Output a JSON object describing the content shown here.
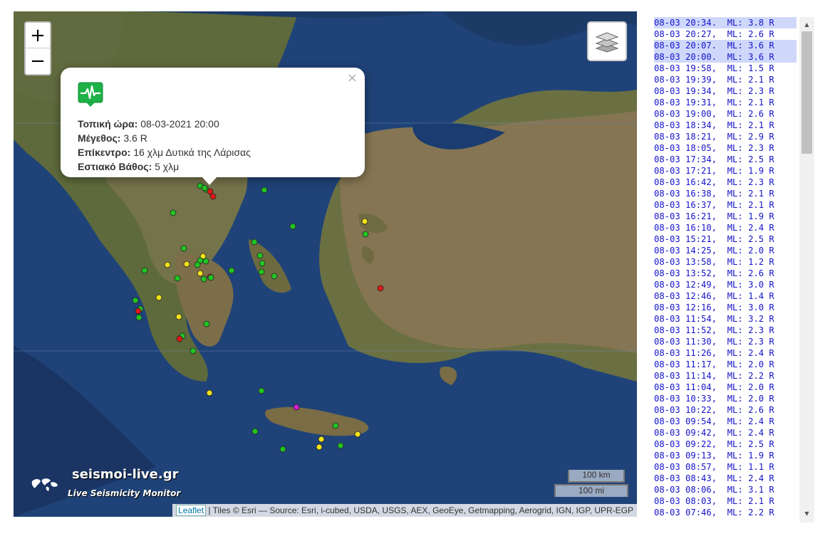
{
  "map": {
    "zoom_in": "+",
    "zoom_out": "−",
    "layers_icon": "layers-icon",
    "popup": {
      "close": "×",
      "icon": "seismograph-icon",
      "time_label": "Τοπική ώρα:",
      "time_value": "08-03-2021 20:00",
      "magnitude_label": "Μέγεθος:",
      "magnitude_value": "3.6 R",
      "epicenter_label": "Επίκεντρο:",
      "epicenter_value": "16 χλμ Δυτικά της Λάρισας",
      "depth_label": "Εστιακό Βάθος:",
      "depth_value": "5 χλμ"
    },
    "logo_title": "seismoi-live.gr",
    "logo_subtitle": "Live Seismicity Monitor",
    "scale_km": "100 km",
    "scale_mi": "100 mi",
    "attribution_link": "Leaflet",
    "attribution_text": " | Tiles © Esri — Source: Esri, i-cubed, USDA, USGS, AEX, GeoEye, Getmapping, Aerogrid, IGN, IGP, UPR-EGP",
    "marker_colors": {
      "green": "#22c422",
      "yellow": "#f2e21a",
      "red": "#e01818",
      "magenta": "#d21ed2"
    }
  },
  "quakes": [
    {
      "text": "08-03 20:34.  ML: 3.8 R",
      "hl": true
    },
    {
      "text": "08-03 20:27,  ML: 2.6 R",
      "hl": false
    },
    {
      "text": "08-03 20:07.  ML: 3.6 R",
      "hl": true
    },
    {
      "text": "08-03 20:00.  ML: 3.6 R",
      "hl": true
    },
    {
      "text": "08-03 19:58,  ML: 1.5 R",
      "hl": false
    },
    {
      "text": "08-03 19:39,  ML: 2.1 R",
      "hl": false
    },
    {
      "text": "08-03 19:34,  ML: 2.3 R",
      "hl": false
    },
    {
      "text": "08-03 19:31,  ML: 2.1 R",
      "hl": false
    },
    {
      "text": "08-03 19:00,  ML: 2.6 R",
      "hl": false
    },
    {
      "text": "08-03 18:34,  ML: 2.1 R",
      "hl": false
    },
    {
      "text": "08-03 18:21,  ML: 2.9 R",
      "hl": false
    },
    {
      "text": "08-03 18:05,  ML: 2.3 R",
      "hl": false
    },
    {
      "text": "08-03 17:34,  ML: 2.5 R",
      "hl": false
    },
    {
      "text": "08-03 17:21,  ML: 1.9 R",
      "hl": false
    },
    {
      "text": "08-03 16:42,  ML: 2.3 R",
      "hl": false
    },
    {
      "text": "08-03 16:38,  ML: 2.1 R",
      "hl": false
    },
    {
      "text": "08-03 16:37,  ML: 2.1 R",
      "hl": false
    },
    {
      "text": "08-03 16:21,  ML: 1.9 R",
      "hl": false
    },
    {
      "text": "08-03 16:10,  ML: 2.4 R",
      "hl": false
    },
    {
      "text": "08-03 15:21,  ML: 2.5 R",
      "hl": false
    },
    {
      "text": "08-03 14:25,  ML: 2.0 R",
      "hl": false
    },
    {
      "text": "08-03 13:58,  ML: 1.2 R",
      "hl": false
    },
    {
      "text": "08-03 13:52,  ML: 2.6 R",
      "hl": false
    },
    {
      "text": "08-03 12:49,  ML: 3.0 R",
      "hl": false
    },
    {
      "text": "08-03 12:46,  ML: 1.4 R",
      "hl": false
    },
    {
      "text": "08-03 12:16,  ML: 3.0 R",
      "hl": false
    },
    {
      "text": "08-03 11:54,  ML: 3.2 R",
      "hl": false
    },
    {
      "text": "08-03 11:52,  ML: 2.3 R",
      "hl": false
    },
    {
      "text": "08-03 11:30,  ML: 2.3 R",
      "hl": false
    },
    {
      "text": "08-03 11:26,  ML: 2.4 R",
      "hl": false
    },
    {
      "text": "08-03 11:17,  ML: 2.0 R",
      "hl": false
    },
    {
      "text": "08-03 11:14,  ML: 2.2 R",
      "hl": false
    },
    {
      "text": "08-03 11:04,  ML: 2.0 R",
      "hl": false
    },
    {
      "text": "08-03 10:33,  ML: 2.0 R",
      "hl": false
    },
    {
      "text": "08-03 10:22,  ML: 2.6 R",
      "hl": false
    },
    {
      "text": "08-03 09:54,  ML: 2.4 R",
      "hl": false
    },
    {
      "text": "08-03 09:42,  ML: 2.4 R",
      "hl": false
    },
    {
      "text": "08-03 09:22,  ML: 2.5 R",
      "hl": false
    },
    {
      "text": "08-03 09:13,  ML: 1.9 R",
      "hl": false
    },
    {
      "text": "08-03 08:57,  ML: 1.1 R",
      "hl": false
    },
    {
      "text": "08-03 08:43,  ML: 2.4 R",
      "hl": false
    },
    {
      "text": "08-03 08:06,  ML: 3.1 R",
      "hl": false
    },
    {
      "text": "08-03 08:03,  ML: 2.1 R",
      "hl": false
    },
    {
      "text": "08-03 07:46,  ML: 2.2 R",
      "hl": false
    }
  ],
  "scrollbar": {
    "up": "▲",
    "down": "▼"
  }
}
